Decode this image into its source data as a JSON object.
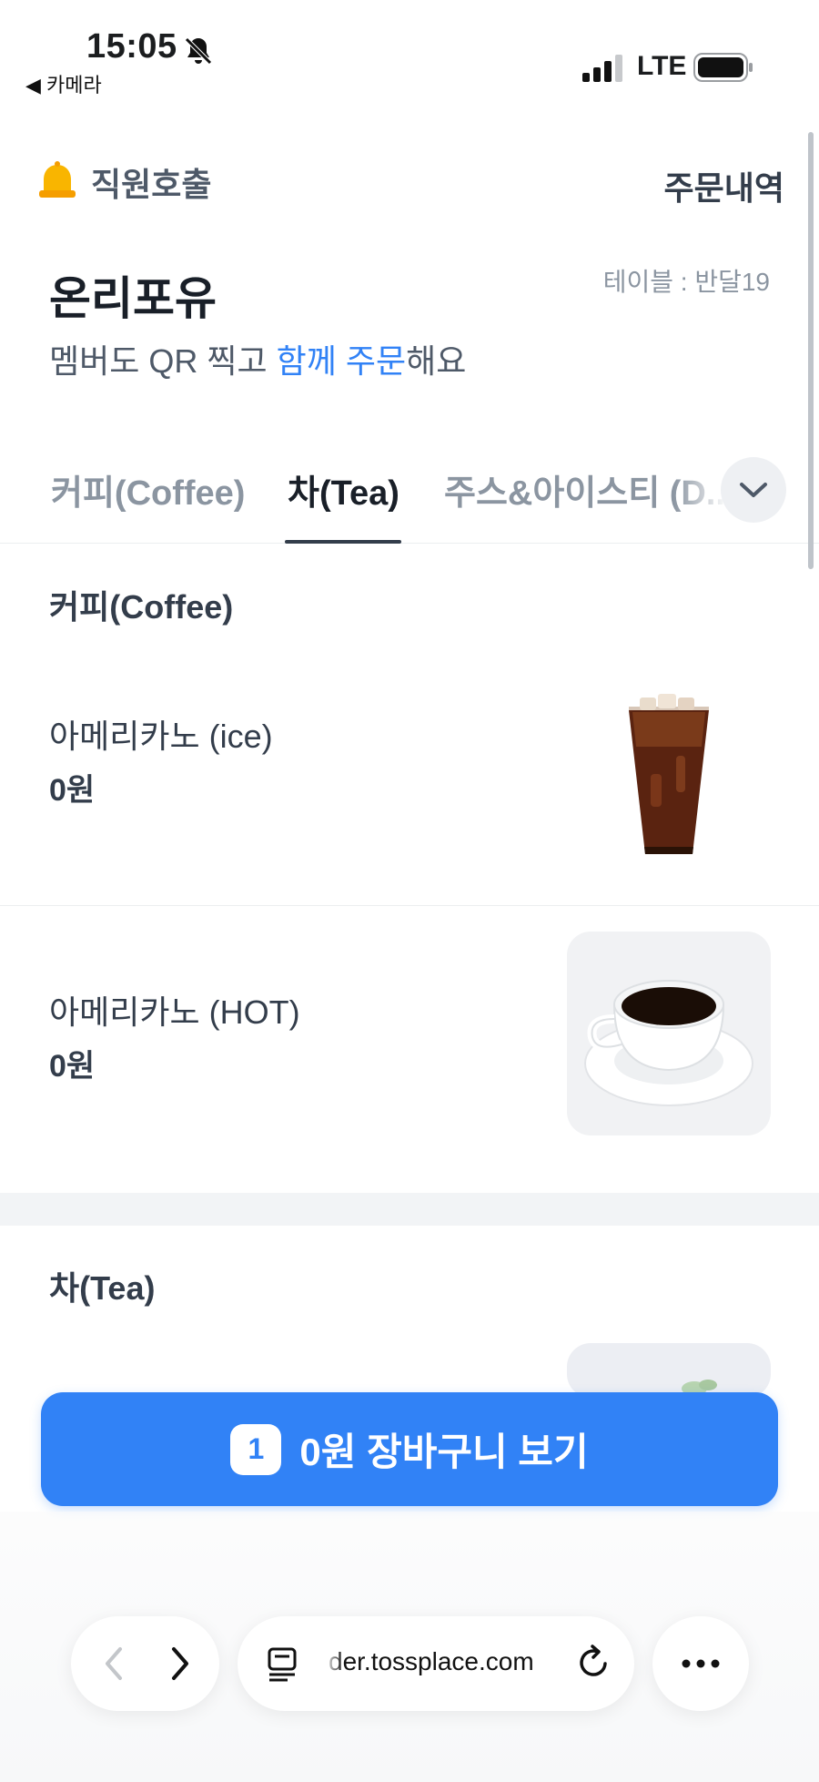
{
  "status_bar": {
    "time": "15:05",
    "back_app": "◀ 카메라",
    "network": "LTE",
    "icons": [
      "bell-slash-icon",
      "signal-icon",
      "battery-icon"
    ]
  },
  "header": {
    "call_staff_label": "직원호출",
    "order_history_label": "주문내역",
    "store_name": "온리포유",
    "table_label": "테이블 : 반달19",
    "subtitle_pre": "멤버도 QR 찍고 ",
    "subtitle_highlight": "함께 주문",
    "subtitle_post": "해요",
    "accent_color": "#3182f6"
  },
  "tabs": [
    {
      "label": "커피(Coffee)",
      "active": false
    },
    {
      "label": "차(Tea)",
      "active": true
    },
    {
      "label": "주스&아이스티 (D..",
      "active": false
    }
  ],
  "sections": [
    {
      "title": "커피(Coffee)",
      "items": [
        {
          "name": "아메리카노 (ice)",
          "price": "0원",
          "image": "iced-americano-image"
        },
        {
          "name": "아메리카노 (HOT)",
          "price": "0원",
          "image": "hot-americano-image"
        }
      ]
    },
    {
      "title": "차(Tea)",
      "items": []
    }
  ],
  "cart": {
    "count": "1",
    "label": "0원 장바구니 보기"
  },
  "browser": {
    "url": "der.tossplace.com"
  }
}
